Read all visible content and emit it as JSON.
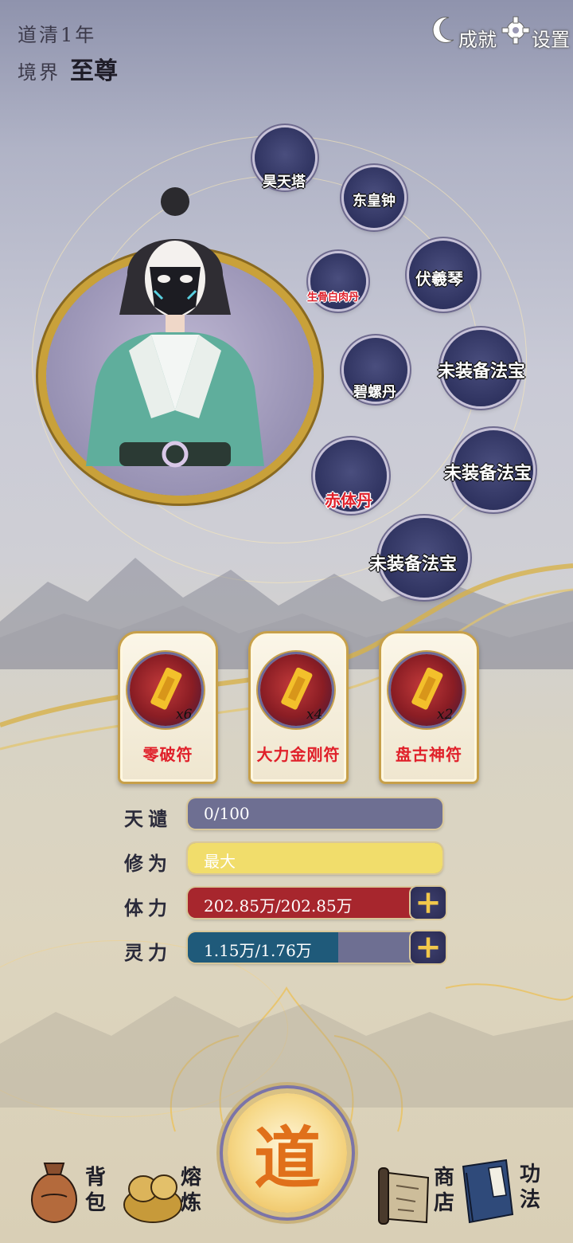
{
  "header": {
    "year_text": "道清1年",
    "realm_label": "境界",
    "realm_value": "至尊"
  },
  "top_buttons": {
    "achievements_label": "成就",
    "settings_label": "设置"
  },
  "treasure_slots": [
    {
      "label": "昊天塔",
      "state": "equipped"
    },
    {
      "label": "东皇钟",
      "state": "equipped"
    },
    {
      "label": "生骨白肉丹",
      "state": "equipped"
    },
    {
      "label": "伏羲琴",
      "state": "equipped"
    },
    {
      "label": "碧螺丹",
      "state": "equipped"
    },
    {
      "label": "未装备法宝",
      "state": "empty"
    },
    {
      "label": "赤体丹",
      "state": "equipped"
    },
    {
      "label": "未装备法宝",
      "state": "empty"
    },
    {
      "label": "未装备法宝",
      "state": "empty"
    }
  ],
  "talismans": [
    {
      "name": "零破符",
      "count": "x6"
    },
    {
      "name": "大力金刚符",
      "count": "x4"
    },
    {
      "name": "盘古神符",
      "count": "x2"
    }
  ],
  "stats": {
    "tianqian": {
      "label": "天谴",
      "value": "0/100",
      "fill": 0.0
    },
    "xiuwei": {
      "label": "修为",
      "value": "最大",
      "fill": 1.0
    },
    "tili": {
      "label": "体力",
      "value": "202.85万/202.85万",
      "fill": 1.0
    },
    "lingli": {
      "label": "灵力",
      "value": "1.15万/1.76万",
      "fill": 0.65
    }
  },
  "colors": {
    "tianqian": "#6e6f92",
    "xiuwei": "#f1dd6b",
    "tili": "#a7262d",
    "lingli": "#1f5a7a",
    "gold": "#c9a13a"
  },
  "nav": {
    "bag_label": "背包",
    "smelt_label": "熔炼",
    "center_label": "道",
    "shop_label": "商店",
    "skills_label": "功法"
  }
}
